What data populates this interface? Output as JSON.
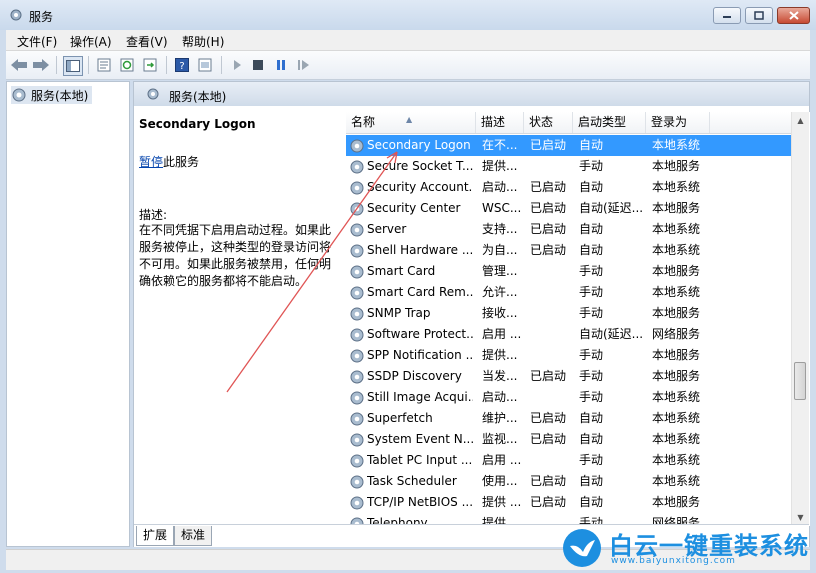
{
  "window": {
    "title": "服务",
    "icon": "gear-icon"
  },
  "menu": [
    "文件(F)",
    "操作(A)",
    "查看(V)",
    "帮助(H)"
  ],
  "toolbar": {
    "icons": [
      "back-arrow-icon",
      "forward-arrow-icon",
      "show-hide-tree-icon",
      "properties-icon",
      "refresh-icon",
      "export-list-icon",
      "help-icon",
      "view-icon",
      "start-service-icon",
      "stop-service-icon",
      "pause-service-icon",
      "restart-service-icon"
    ]
  },
  "tree": {
    "root_label": "服务(本地)"
  },
  "pane": {
    "header": "服务(本地)",
    "selected_service_title": "Secondary Logon",
    "pause_link": "暂停",
    "pause_suffix": "此服务",
    "description_label": "描述:",
    "description_text": "在不同凭据下启用启动过程。如果此服务被停止，这种类型的登录访问将不可用。如果此服务被禁用，任何明确依赖它的服务都将不能启动。"
  },
  "list": {
    "columns": [
      "名称",
      "描述",
      "状态",
      "启动类型",
      "登录为"
    ],
    "rows": [
      {
        "name": "Secondary Logon",
        "desc": "在不...",
        "status": "已启动",
        "start": "自动",
        "logon": "本地系统",
        "selected": true
      },
      {
        "name": "Secure Socket T...",
        "desc": "提供...",
        "status": "",
        "start": "手动",
        "logon": "本地服务"
      },
      {
        "name": "Security Account...",
        "desc": "启动...",
        "status": "已启动",
        "start": "自动",
        "logon": "本地系统"
      },
      {
        "name": "Security Center",
        "desc": "WSC...",
        "status": "已启动",
        "start": "自动(延迟...",
        "logon": "本地服务"
      },
      {
        "name": "Server",
        "desc": "支持...",
        "status": "已启动",
        "start": "自动",
        "logon": "本地系统"
      },
      {
        "name": "Shell Hardware ...",
        "desc": "为自...",
        "status": "已启动",
        "start": "自动",
        "logon": "本地系统"
      },
      {
        "name": "Smart Card",
        "desc": "管理...",
        "status": "",
        "start": "手动",
        "logon": "本地服务"
      },
      {
        "name": "Smart Card Rem...",
        "desc": "允许...",
        "status": "",
        "start": "手动",
        "logon": "本地系统"
      },
      {
        "name": "SNMP Trap",
        "desc": "接收...",
        "status": "",
        "start": "手动",
        "logon": "本地服务"
      },
      {
        "name": "Software Protect...",
        "desc": "启用 ...",
        "status": "",
        "start": "自动(延迟...",
        "logon": "网络服务"
      },
      {
        "name": "SPP Notification ...",
        "desc": "提供...",
        "status": "",
        "start": "手动",
        "logon": "本地服务"
      },
      {
        "name": "SSDP Discovery",
        "desc": "当发...",
        "status": "已启动",
        "start": "手动",
        "logon": "本地服务"
      },
      {
        "name": "Still Image Acqui...",
        "desc": "启动...",
        "status": "",
        "start": "手动",
        "logon": "本地系统"
      },
      {
        "name": "Superfetch",
        "desc": "维护...",
        "status": "已启动",
        "start": "自动",
        "logon": "本地系统"
      },
      {
        "name": "System Event N...",
        "desc": "监视...",
        "status": "已启动",
        "start": "自动",
        "logon": "本地系统"
      },
      {
        "name": "Tablet PC Input ...",
        "desc": "启用 ...",
        "status": "",
        "start": "手动",
        "logon": "本地系统"
      },
      {
        "name": "Task Scheduler",
        "desc": "使用...",
        "status": "已启动",
        "start": "自动",
        "logon": "本地系统"
      },
      {
        "name": "TCP/IP NetBIOS ...",
        "desc": "提供 ...",
        "status": "已启动",
        "start": "自动",
        "logon": "本地服务"
      },
      {
        "name": "Telephony",
        "desc": "提供...",
        "status": "",
        "start": "手动",
        "logon": "网络服务"
      }
    ]
  },
  "tabs": [
    "扩展",
    "标准"
  ],
  "watermark": {
    "text": "白云一键重装系统",
    "url": "www.baiyunxitong.com",
    "icon": "bird-logo-icon"
  },
  "colors": {
    "selection": "#3399ff",
    "annotation_arrow": "#e05555",
    "watermark": "#1d8fe0"
  }
}
